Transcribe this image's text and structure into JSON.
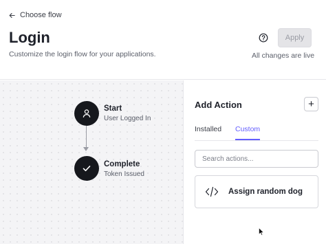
{
  "header": {
    "back_label": "Choose flow",
    "title": "Login",
    "subtitle": "Customize the login flow for your applications.",
    "apply_label": "Apply",
    "status_text": "All changes are live",
    "help_icon": "help-circle-icon"
  },
  "flow": {
    "nodes": [
      {
        "title": "Start",
        "subtitle": "User Logged In",
        "icon": "user-icon"
      },
      {
        "title": "Complete",
        "subtitle": "Token Issued",
        "icon": "check-icon"
      }
    ]
  },
  "panel": {
    "title": "Add Action",
    "add_label": "+",
    "tabs": [
      {
        "label": "Installed",
        "active": false
      },
      {
        "label": "Custom",
        "active": true
      }
    ],
    "search": {
      "placeholder": "Search actions...",
      "value": ""
    },
    "actions": [
      {
        "label": "Assign random dog",
        "icon": "code-icon"
      }
    ]
  },
  "colors": {
    "accent": "#635dff",
    "node": "#16181d",
    "canvas_bg": "#f4f4f6",
    "apply_disabled_bg": "#e4e4e7"
  }
}
